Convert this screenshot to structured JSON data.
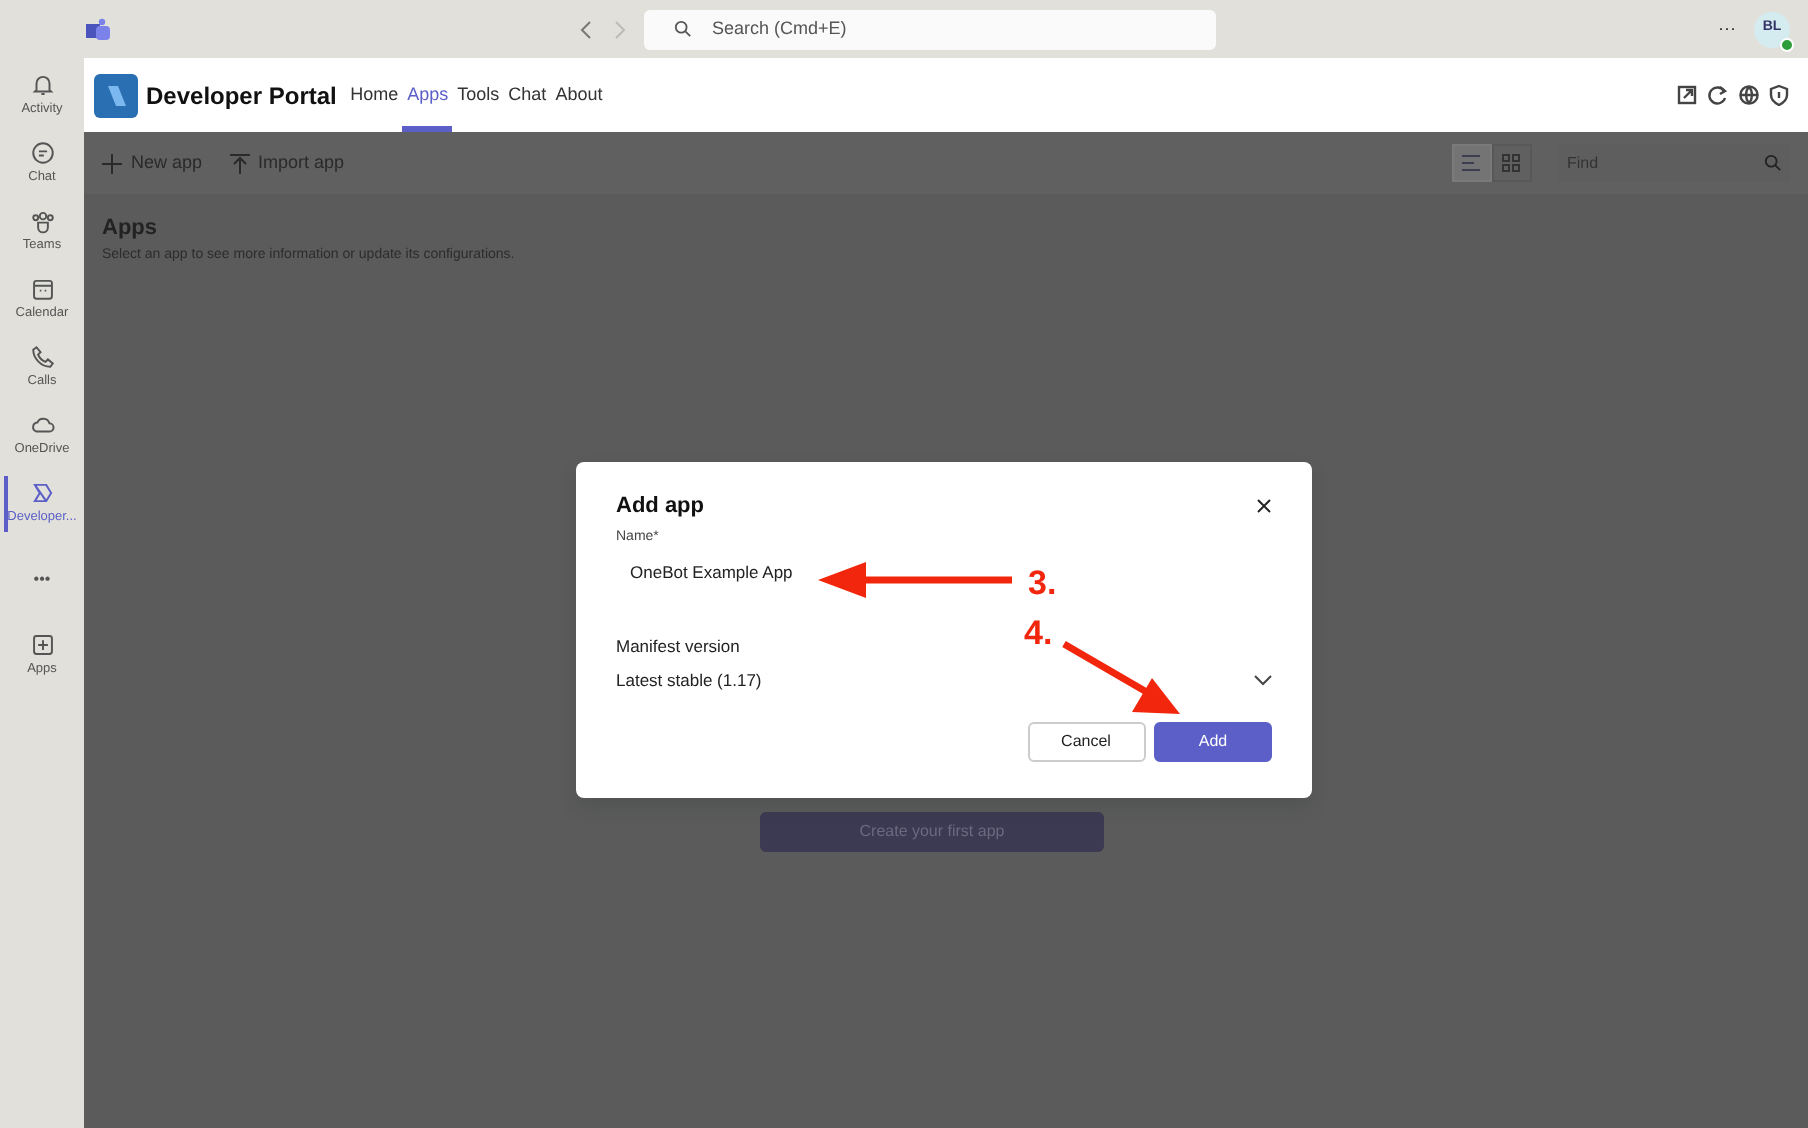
{
  "top_bar": {
    "search": {
      "placeholder": "Search (Cmd+E)"
    },
    "more": "···",
    "avatar": {
      "initials": "BL",
      "online": true
    }
  },
  "sidebar": {
    "items": [
      {
        "kind": "bell",
        "label": "Activity",
        "selected": false
      },
      {
        "kind": "chat",
        "label": "Chat",
        "selected": false
      },
      {
        "kind": "teams",
        "label": "Teams",
        "selected": false
      },
      {
        "kind": "calendar",
        "label": "Calendar",
        "selected": false
      },
      {
        "kind": "phone",
        "label": "Calls",
        "selected": false
      },
      {
        "kind": "cloud",
        "label": "OneDrive",
        "selected": false
      },
      {
        "kind": "devportal",
        "label": "Developer...",
        "selected": true
      },
      {
        "kind": "more",
        "label": "•••",
        "selected": false
      },
      {
        "kind": "plus",
        "label": "Apps",
        "selected": false
      }
    ]
  },
  "app_header": {
    "title": "Developer Portal",
    "tabs": [
      {
        "label": "Home",
        "selected": false
      },
      {
        "label": "Apps",
        "selected": true
      },
      {
        "label": "Tools",
        "selected": false
      },
      {
        "label": "Chat",
        "selected": false
      },
      {
        "label": "About",
        "selected": false
      }
    ]
  },
  "toolbar": {
    "actions": [
      {
        "kind": "plus",
        "label": "New app"
      },
      {
        "kind": "upload",
        "label": "Import app"
      }
    ],
    "views": [
      {
        "kind": "list",
        "selected": true
      },
      {
        "kind": "grid",
        "selected": false
      }
    ],
    "find": {
      "placeholder": "Find"
    }
  },
  "content": {
    "title": "Apps",
    "subtitle": "Select an app to see more information or update its configurations.",
    "create_button": "Create your first app"
  },
  "dialog": {
    "title": "Add app",
    "name_label": "Name*",
    "name_value": "OneBot Example App",
    "manifest_label": "Manifest version",
    "manifest_value": "Latest stable (1.17)",
    "buttons": [
      {
        "kind": "secondary",
        "label": "Cancel"
      },
      {
        "kind": "primary",
        "label": "Add"
      }
    ]
  },
  "annotations": [
    {
      "label": "3."
    },
    {
      "label": "4."
    }
  ]
}
